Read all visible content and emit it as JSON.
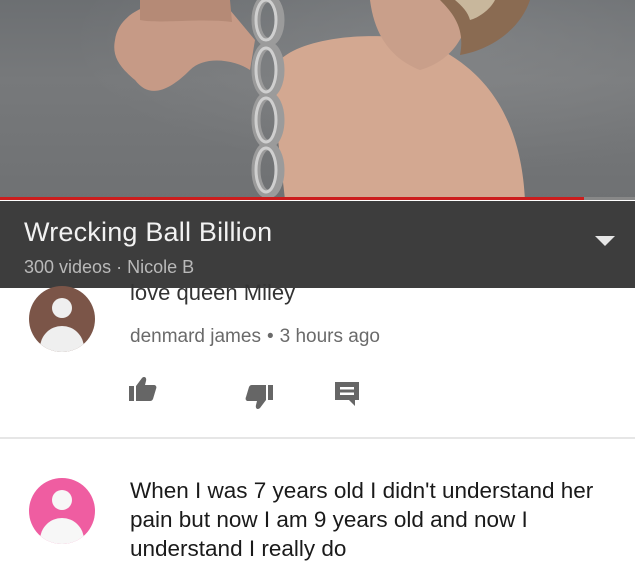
{
  "video": {
    "progress_percent": 92,
    "colors": {
      "progress": "#cc1d1d"
    }
  },
  "playlist": {
    "title": "Wrecking Ball Billion",
    "video_count": "300 videos",
    "separator": "·",
    "owner": "Nicole B"
  },
  "comments": [
    {
      "text": "love queen Miley",
      "author": "denmard james",
      "separator": "•",
      "time": "3 hours ago",
      "avatar_color": "#7b5548",
      "actions": {
        "like": "thumb-up-icon",
        "dislike": "thumb-down-icon",
        "reply": "reply-icon"
      }
    },
    {
      "text": "When I was 7 years old I didn't understand her pain but now I am 9 years old and now I understand I really do",
      "avatar_color": "#ef5da1"
    }
  ]
}
